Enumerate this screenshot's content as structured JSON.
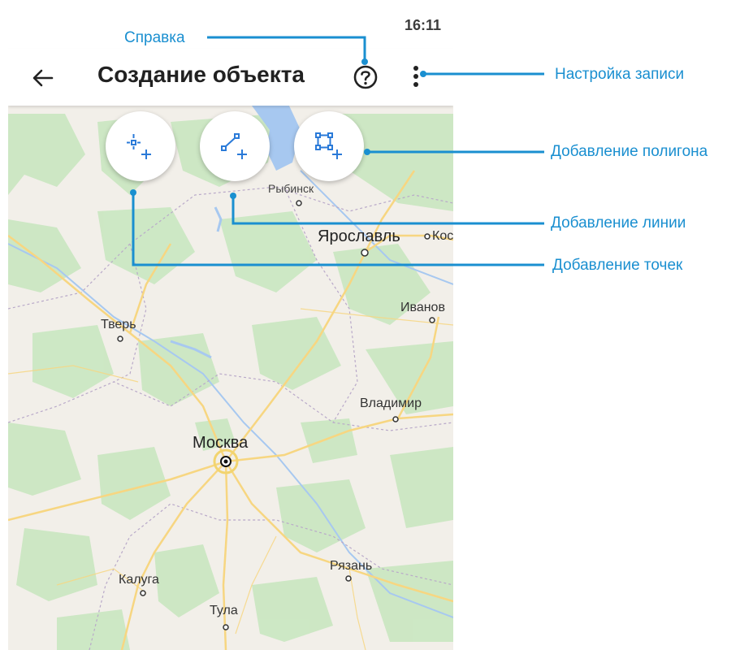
{
  "status_bar": {
    "time": "16:11"
  },
  "app_bar": {
    "title": "Создание объекта"
  },
  "toolbar_buttons": [
    "add-point",
    "add-line",
    "add-polygon"
  ],
  "map": {
    "cities": [
      {
        "name": "Рыбинск"
      },
      {
        "name": "Ярославль"
      },
      {
        "name": "Кос"
      },
      {
        "name": "Иванов"
      },
      {
        "name": "Тверь"
      },
      {
        "name": "Владимир"
      },
      {
        "name": "Москва"
      },
      {
        "name": "Рязань"
      },
      {
        "name": "Калуга"
      },
      {
        "name": "Тула"
      }
    ]
  },
  "callouts": {
    "help": "Справка",
    "record_settings": "Настройка записи",
    "add_polygon": "Добавление полигона",
    "add_line": "Добавление линии",
    "add_points": "Добавление точек"
  },
  "colors": {
    "accent": "#1a8fd0",
    "icon_blue": "#2a7ad8"
  }
}
